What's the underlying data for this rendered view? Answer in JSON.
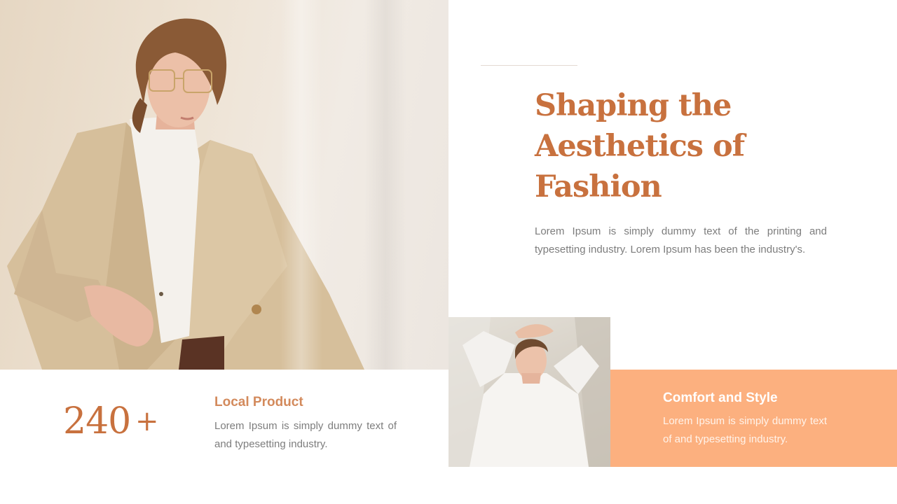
{
  "hero": {
    "headline_lines": [
      "Shaping the",
      "Aesthetics of",
      "Fashion"
    ],
    "intro": "Lorem Ipsum is simply dummy text of the printing and typesetting industry.  Lorem Ipsum has been the industry's."
  },
  "stat": {
    "number": "240",
    "suffix": "+",
    "title": "Local Product",
    "body": "Lorem Ipsum is simply dummy text of and typesetting industry."
  },
  "card": {
    "title": "Comfort and Style",
    "body": "Lorem Ipsum is simply dummy text of and typesetting industry."
  },
  "colors": {
    "accent": "#c8713e",
    "card_background": "#fcb07f",
    "body_text": "#7d7d7d"
  }
}
